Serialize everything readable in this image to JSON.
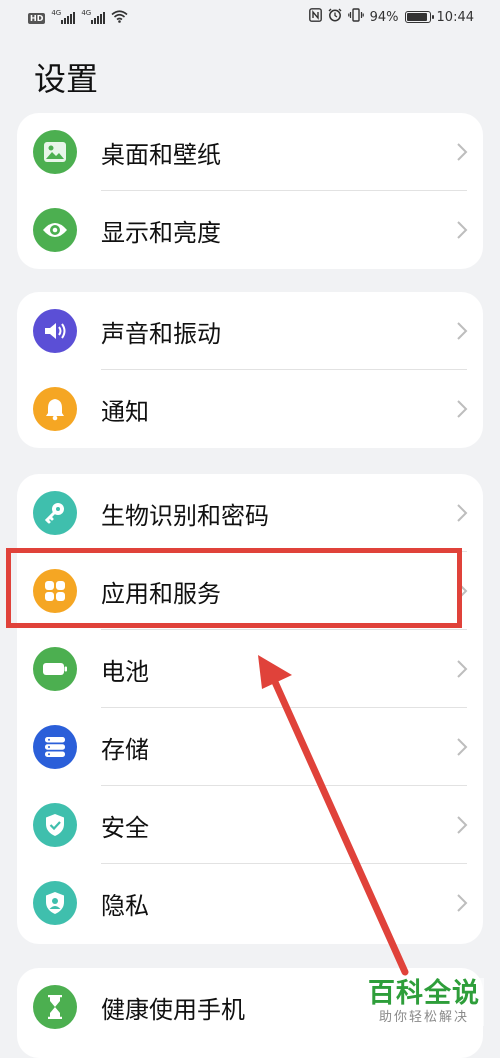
{
  "status_bar": {
    "hd_badge": "HD",
    "sim1_network": "4G",
    "sim2_network": "4G",
    "battery_percent": "94%",
    "time": "10:44"
  },
  "page": {
    "title": "设置"
  },
  "groups": [
    {
      "items": [
        {
          "label": "桌面和壁纸",
          "icon": "image-icon",
          "color": "#4caf50"
        },
        {
          "label": "显示和亮度",
          "icon": "eye-icon",
          "color": "#4caf50"
        }
      ]
    },
    {
      "items": [
        {
          "label": "声音和振动",
          "icon": "speaker-icon",
          "color": "#5b4fd6"
        },
        {
          "label": "通知",
          "icon": "bell-icon",
          "color": "#f5a623"
        }
      ]
    },
    {
      "items": [
        {
          "label": "生物识别和密码",
          "icon": "key-icon",
          "color": "#3fbfad"
        },
        {
          "label": "应用和服务",
          "icon": "apps-grid-icon",
          "color": "#f5a623"
        },
        {
          "label": "电池",
          "icon": "battery-icon",
          "color": "#4caf50"
        },
        {
          "label": "存储",
          "icon": "storage-icon",
          "color": "#2b5fd9"
        },
        {
          "label": "安全",
          "icon": "shield-check-icon",
          "color": "#3fbfad"
        },
        {
          "label": "隐私",
          "icon": "privacy-shield-icon",
          "color": "#3fbfad"
        }
      ]
    },
    {
      "items": [
        {
          "label": "健康使用手机",
          "icon": "hourglass-icon",
          "color": "#4caf50"
        }
      ]
    }
  ],
  "annotation": {
    "highlight_color": "#e0423a",
    "highlighted_item": "应用和服务"
  },
  "watermark": {
    "brand": "百科全说",
    "slogan": "助你轻松解决"
  }
}
